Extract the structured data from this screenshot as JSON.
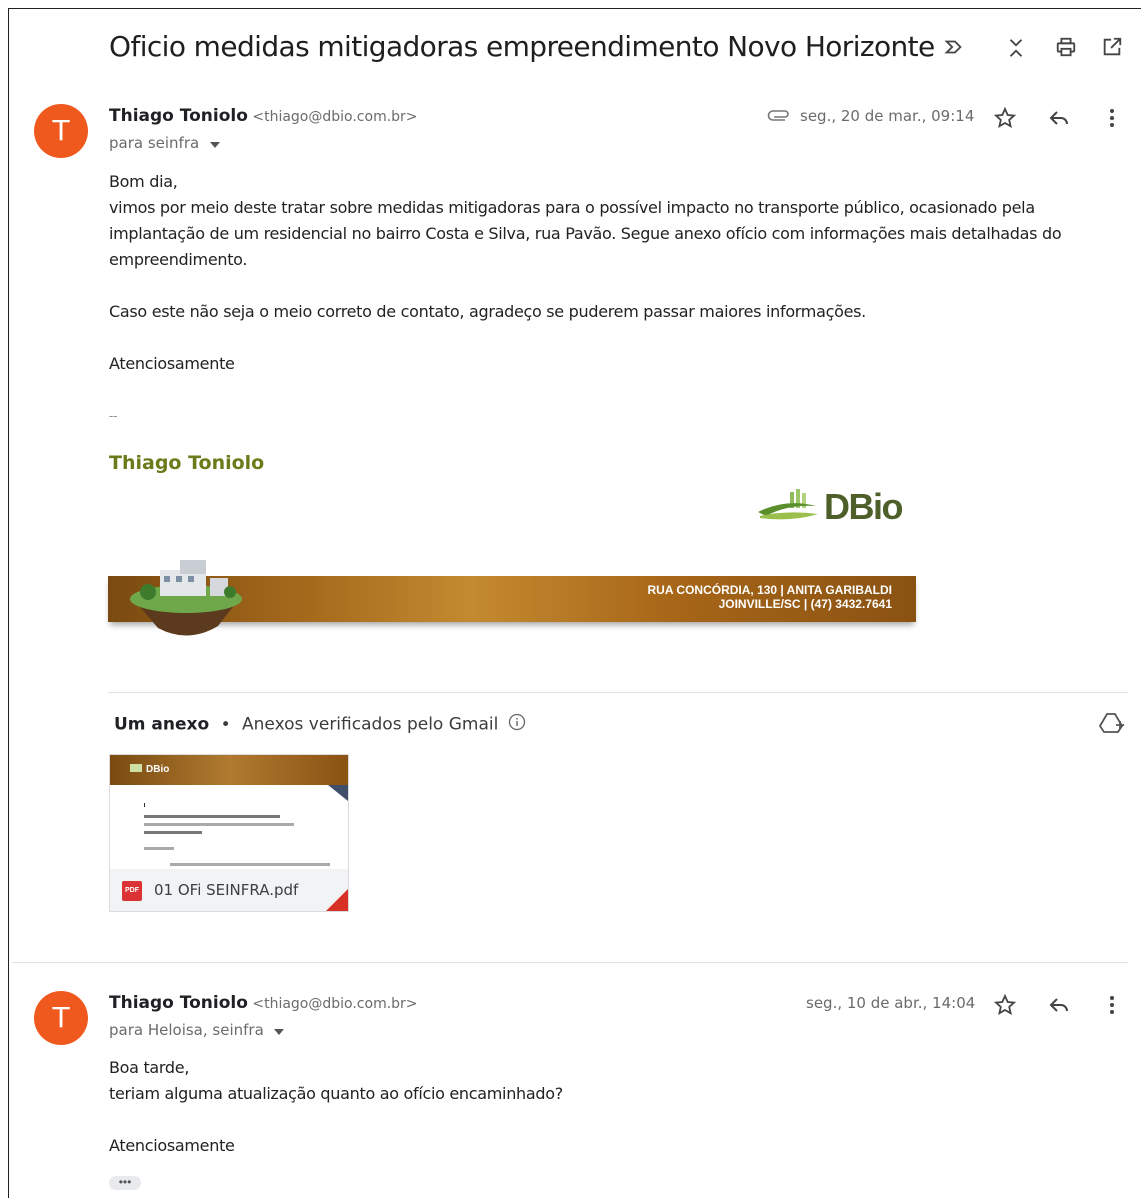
{
  "thread": {
    "subject": "Oficio medidas mitigadoras empreendimento Novo Horizonte"
  },
  "header_icons": [
    "label-forward-icon",
    "collapse-icon",
    "print-icon",
    "open-new-window-icon"
  ],
  "messages": [
    {
      "avatar_letter": "T",
      "sender_name": "Thiago Toniolo",
      "sender_email": "<thiago@dbio.com.br>",
      "to": "para seinfra",
      "date": "seg., 20 de mar., 09:14",
      "body": [
        "Bom dia,",
        "vimos por meio deste tratar sobre medidas mitigadoras para o possível impacto no transporte público, ocasionado pela implantação de um residencial no bairro Costa e Silva, rua Pavão. Segue anexo ofício com informações mais detalhadas do empreendimento.",
        "Caso este não seja o meio correto de contato, agradeço se puderem passar maiores informações.",
        "Atenciosamente",
        "--"
      ],
      "signature": {
        "name": "Thiago Toniolo",
        "logo_text": "DBio",
        "banner_line1": "RUA CONCÓRDIA, 130 | ANITA GARIBALDI",
        "banner_line2": "JOINVILLE/SC | (47) 3432.7641"
      },
      "attachments": {
        "count_label": "Um anexo",
        "separator": "•",
        "scan_label": "Anexos verificados pelo Gmail",
        "files": [
          {
            "name": "01 OFi SEINFRA.pdf",
            "badge": "PDF",
            "preview_logo": "DBio"
          }
        ]
      }
    },
    {
      "avatar_letter": "T",
      "sender_name": "Thiago Toniolo",
      "sender_email": "<thiago@dbio.com.br>",
      "to": "para Heloisa, seinfra",
      "date": "seg., 10 de abr., 14:04",
      "body": [
        "Boa tarde,",
        "teriam alguma atualização quanto ao ofício encaminhado?",
        "Atenciosamente"
      ],
      "trimmed_label": "•••"
    }
  ]
}
